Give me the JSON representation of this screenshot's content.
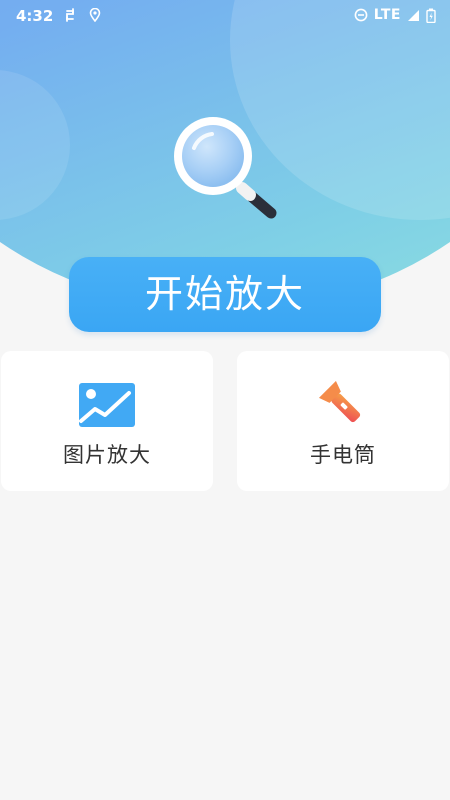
{
  "status_bar": {
    "time": "4:32",
    "network": "LTE",
    "left_icons": [
      "sync-icon",
      "location-icon"
    ],
    "right_icons": [
      "do-not-disturb-icon",
      "signal-icon",
      "battery-icon"
    ]
  },
  "hero": {
    "illustration": "magnifier-icon",
    "colors": {
      "gradient_start": "#6f9bf0",
      "gradient_end": "#8fe0de"
    }
  },
  "start_button": {
    "label": "开始放大",
    "color": "#3aa6f4"
  },
  "features": [
    {
      "label": "图片放大",
      "icon": "image-icon",
      "color": "#3aa6f4"
    },
    {
      "label": "手电筒",
      "icon": "flashlight-icon",
      "color": "#f06a4a"
    }
  ]
}
